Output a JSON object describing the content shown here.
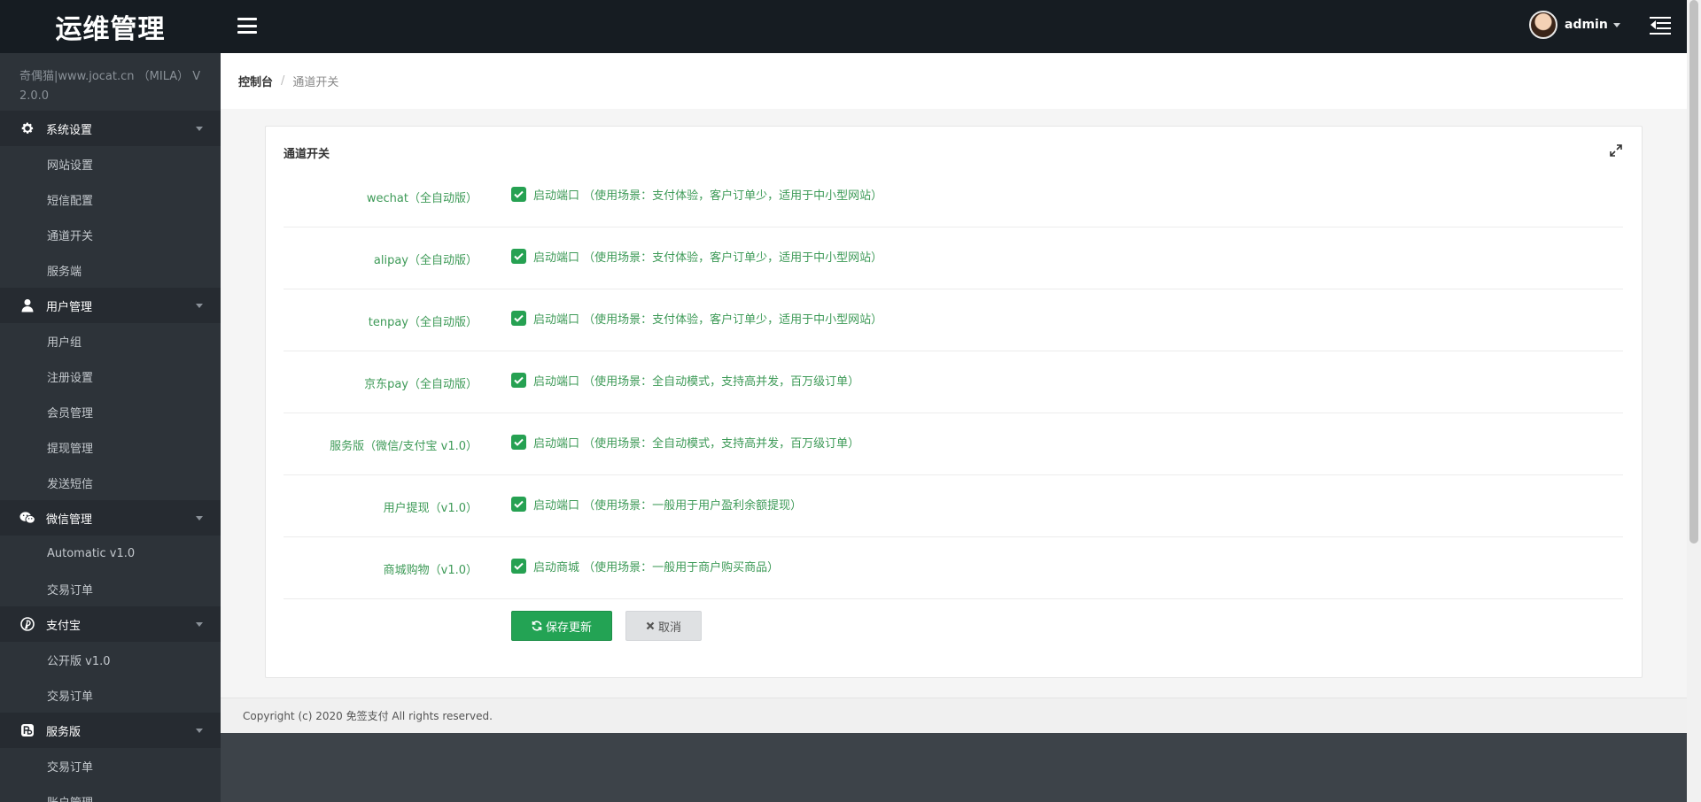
{
  "app": {
    "brand": "运维管理"
  },
  "header": {
    "username": "admin"
  },
  "sidebar": {
    "site_name": "奇偶猫|www.jocat.cn （MILA） V 2.0.0",
    "groups": [
      {
        "title": "系统设置",
        "icon": "gear-icon",
        "items": [
          "网站设置",
          "短信配置",
          "通道开关",
          "服务端"
        ]
      },
      {
        "title": "用户管理",
        "icon": "user-icon",
        "items": [
          "用户组",
          "注册设置",
          "会员管理",
          "提现管理",
          "发送短信"
        ]
      },
      {
        "title": "微信管理",
        "icon": "wechat-icon",
        "items": [
          "Automatic v1.0",
          "交易订单"
        ]
      },
      {
        "title": "支付宝",
        "icon": "pinterest-icon",
        "items": [
          "公开版 v1.0",
          "交易订单"
        ]
      },
      {
        "title": "服务版",
        "icon": "service-icon",
        "items": [
          "交易订单",
          "账户管理"
        ]
      }
    ]
  },
  "breadcrumb": {
    "home": "控制台",
    "current": "通道开关"
  },
  "panel": {
    "title": "通道开关",
    "rows": [
      {
        "label": "wechat（全自动版）",
        "option": "启动端口 （使用场景：支付体验，客户订单少，适用于中小型网站）",
        "checked": true
      },
      {
        "label": "alipay（全自动版）",
        "option": "启动端口 （使用场景：支付体验，客户订单少，适用于中小型网站）",
        "checked": true
      },
      {
        "label": "tenpay（全自动版）",
        "option": "启动端口 （使用场景：支付体验，客户订单少，适用于中小型网站）",
        "checked": true
      },
      {
        "label": "京东pay（全自动版）",
        "option": "启动端口 （使用场景：全自动模式，支持高并发，百万级订单）",
        "checked": true
      },
      {
        "label": "服务版（微信/支付宝 v1.0）",
        "option": "启动端口 （使用场景：全自动模式，支持高并发，百万级订单）",
        "checked": true
      },
      {
        "label": "用户提现（v1.0）",
        "option": "启动端口 （使用场景：一般用于用户盈利余额提现）",
        "checked": true
      },
      {
        "label": "商城购物（v1.0）",
        "option": "启动商城 （使用场景：一般用于商户购买商品）",
        "checked": true
      }
    ],
    "save_label": "保存更新",
    "cancel_label": "取消"
  },
  "footer": {
    "copyright": "Copyright (c) 2020 免签支付 All rights reserved."
  },
  "colors": {
    "accent_green": "#26a152",
    "label_green": "#3d9a57",
    "topbar": "#161c22",
    "sidebar": "#2d3339"
  }
}
